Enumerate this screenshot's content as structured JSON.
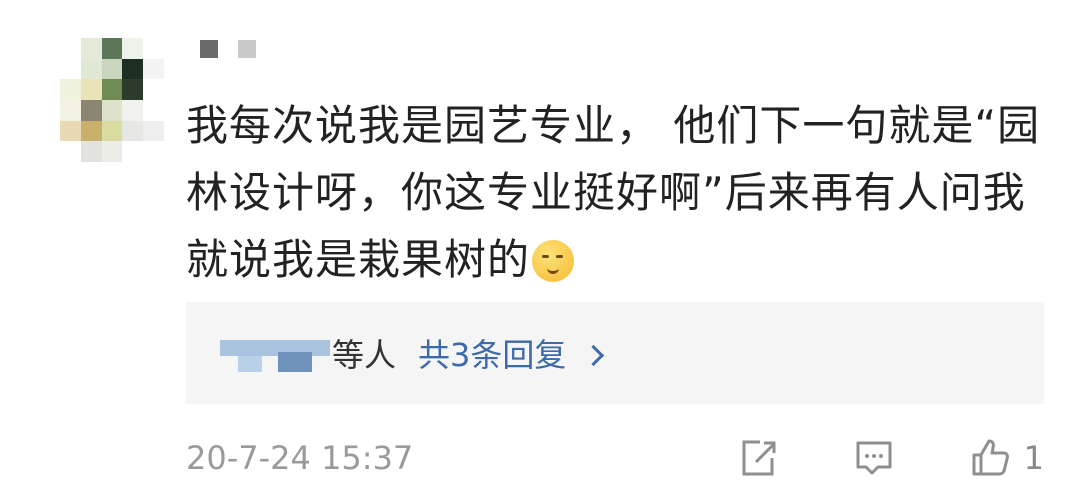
{
  "comment": {
    "text": "我每次说我是园艺专业， 他们下一句就是“园林设计呀，你这专业挺好啊”后来再有人问我就说我是栽果树的",
    "emoji_icon": "shushing-face-icon"
  },
  "replies": {
    "suffix": "等人",
    "link": "共3条回复"
  },
  "footer": {
    "timestamp": "20-7-24 15:37",
    "like_count": "1"
  },
  "icons": {
    "share": "share-icon",
    "reply": "comment-icon",
    "like": "thumbs-up-icon",
    "chevron": "chevron-right-icon"
  },
  "colors": {
    "link": "#3d6aa8",
    "text": "#222222",
    "meta": "#9a9a9a",
    "reply_bg": "#f5f5f5"
  }
}
